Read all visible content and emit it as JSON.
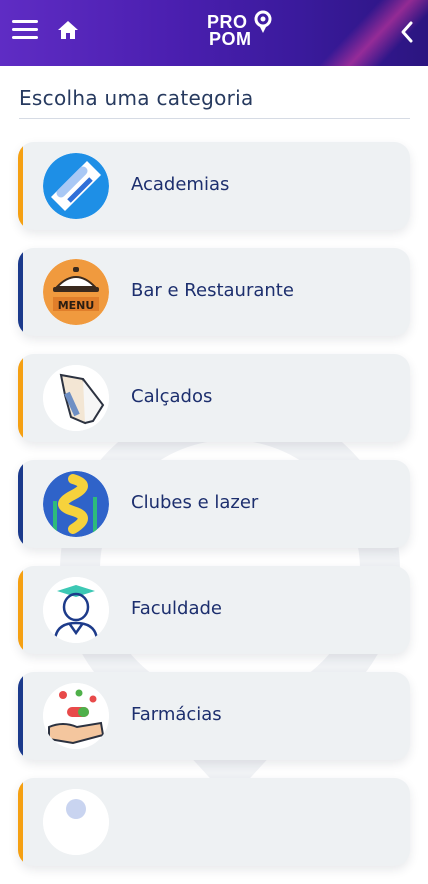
{
  "header": {
    "logo_line1": "PRO",
    "logo_line2": "POM",
    "menu_icon": "hamburger-menu-icon",
    "home_icon": "home-icon",
    "back_icon": "chevron-left-icon"
  },
  "page": {
    "title": "Escolha uma categoria"
  },
  "categories": [
    {
      "label": "Academias",
      "accent": "#f5a012",
      "icon": "fitness-icon"
    },
    {
      "label": "Bar e Restaurante",
      "accent": "#1b3a8c",
      "icon": "menu-cloche-icon"
    },
    {
      "label": "Calçados",
      "accent": "#f5a012",
      "icon": "shoe-icon"
    },
    {
      "label": "Clubes e lazer",
      "accent": "#1b3a8c",
      "icon": "water-slide-icon"
    },
    {
      "label": "Faculdade",
      "accent": "#f5a012",
      "icon": "graduate-icon"
    },
    {
      "label": "Farmácias",
      "accent": "#1b3a8c",
      "icon": "pills-hand-icon"
    },
    {
      "label": "",
      "accent": "#f5a012",
      "icon": "category-icon"
    }
  ]
}
